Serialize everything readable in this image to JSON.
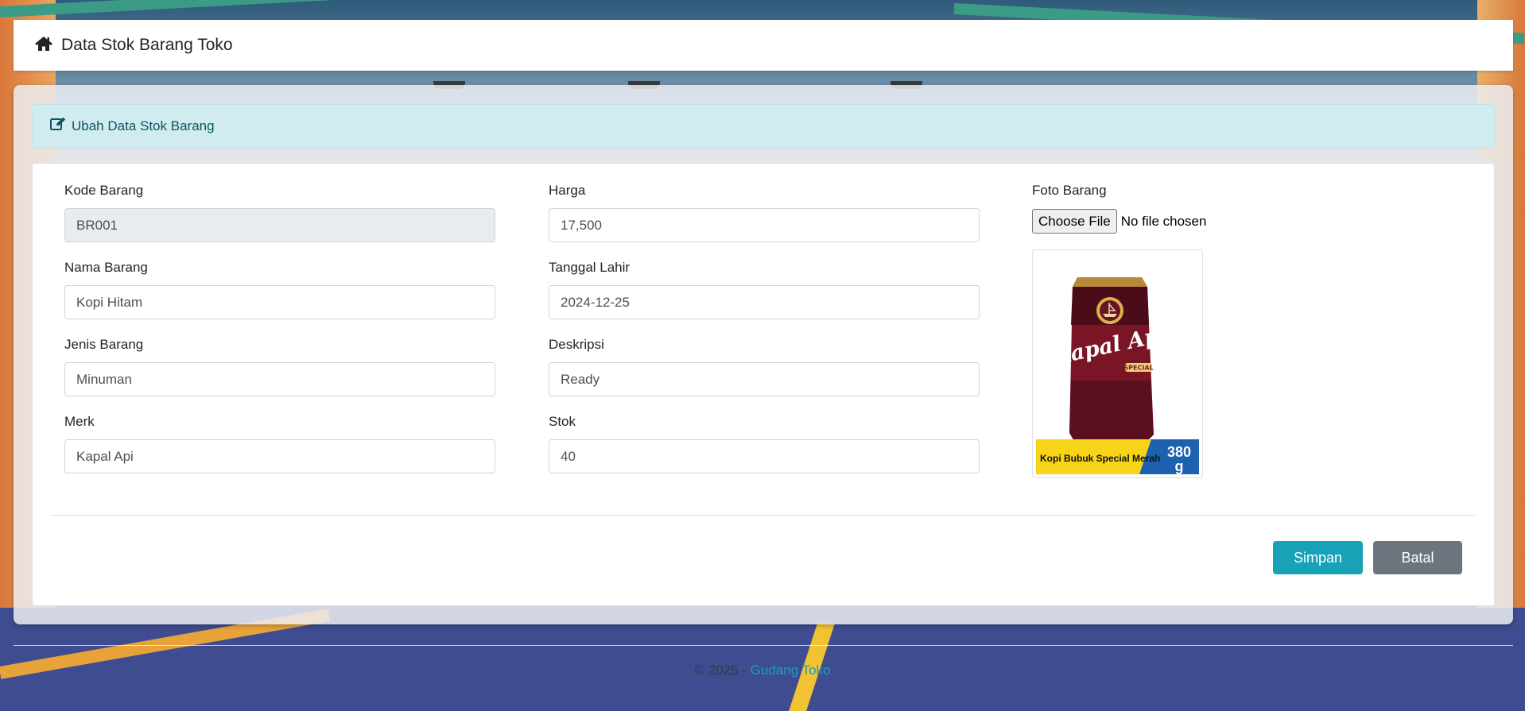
{
  "navbar": {
    "title": "Data Stok Barang Toko",
    "icon": "home-icon"
  },
  "card": {
    "header_title": "Ubah Data Stok Barang",
    "header_icon": "edit-icon"
  },
  "form": {
    "kode_barang": {
      "label": "Kode Barang",
      "value": "BR001"
    },
    "nama_barang": {
      "label": "Nama Barang",
      "value": "Kopi Hitam"
    },
    "jenis_barang": {
      "label": "Jenis Barang",
      "value": "Minuman"
    },
    "merk": {
      "label": "Merk",
      "value": "Kapal Api"
    },
    "harga": {
      "label": "Harga",
      "value": "17,500"
    },
    "tanggal": {
      "label": "Tanggal Lahir",
      "value": "2024-12-25"
    },
    "deskripsi": {
      "label": "Deskripsi",
      "value": "Ready"
    },
    "stok": {
      "label": "Stok",
      "value": "40"
    },
    "foto": {
      "label": "Foto Barang",
      "button_label": "Choose File",
      "status": "No file chosen"
    }
  },
  "product_image": {
    "brand": "Kapal Api",
    "variant": "SPECIAL",
    "caption": "Kopi Bubuk Special Merah",
    "weight": "380",
    "weight_unit": "g"
  },
  "actions": {
    "save_label": "Simpan",
    "cancel_label": "Batal"
  },
  "footer": {
    "copyright": "© 2025 - ",
    "link_text": "Gudang Toko"
  },
  "colors": {
    "info": "#17a2b8",
    "secondary": "#6c757d",
    "alert_bg": "#d1ecf1",
    "product_red": "#8b1a2b"
  }
}
